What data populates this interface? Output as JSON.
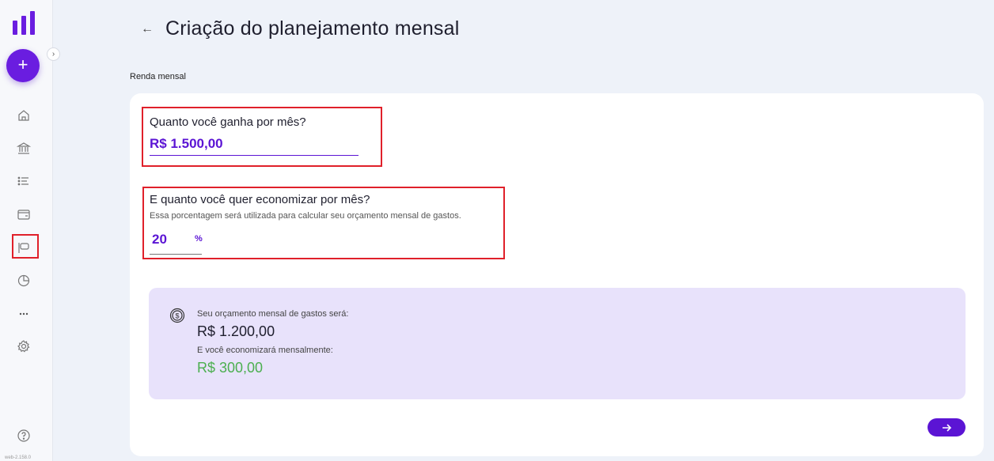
{
  "app": {
    "version": "web-2.158.0"
  },
  "sidebar": {
    "add_label": "+",
    "collapse_label": "›",
    "items": [
      {
        "name": "home",
        "icon": "home-icon"
      },
      {
        "name": "accounts",
        "icon": "bank-icon"
      },
      {
        "name": "transactions",
        "icon": "list-icon"
      },
      {
        "name": "cards",
        "icon": "card-icon"
      },
      {
        "name": "planning",
        "icon": "flag-icon",
        "active": true
      },
      {
        "name": "reports",
        "icon": "pie-chart-icon"
      },
      {
        "name": "more",
        "icon": "more-icon"
      },
      {
        "name": "settings",
        "icon": "gear-icon"
      },
      {
        "name": "help",
        "icon": "help-icon"
      }
    ]
  },
  "header": {
    "back_label": "←",
    "title": "Criação do planejamento mensal"
  },
  "section": {
    "label": "Renda mensal"
  },
  "income": {
    "question": "Quanto você ganha por mês?",
    "value": "R$ 1.500,00"
  },
  "savings": {
    "question": "E quanto você quer economizar por mês?",
    "help": "Essa porcentagem será utilizada para calcular seu orçamento mensal de gastos.",
    "value": "20",
    "unit": "%"
  },
  "summary": {
    "budget_label": "Seu orçamento mensal de gastos será:",
    "budget_value": "R$ 1.200,00",
    "savings_label": "E você economizará mensalmente:",
    "savings_value": "R$ 300,00"
  },
  "colors": {
    "accent": "#5b14d4",
    "highlight": "#e0202a",
    "positive": "#4caf50",
    "summary_bg": "#e8e2fb"
  }
}
